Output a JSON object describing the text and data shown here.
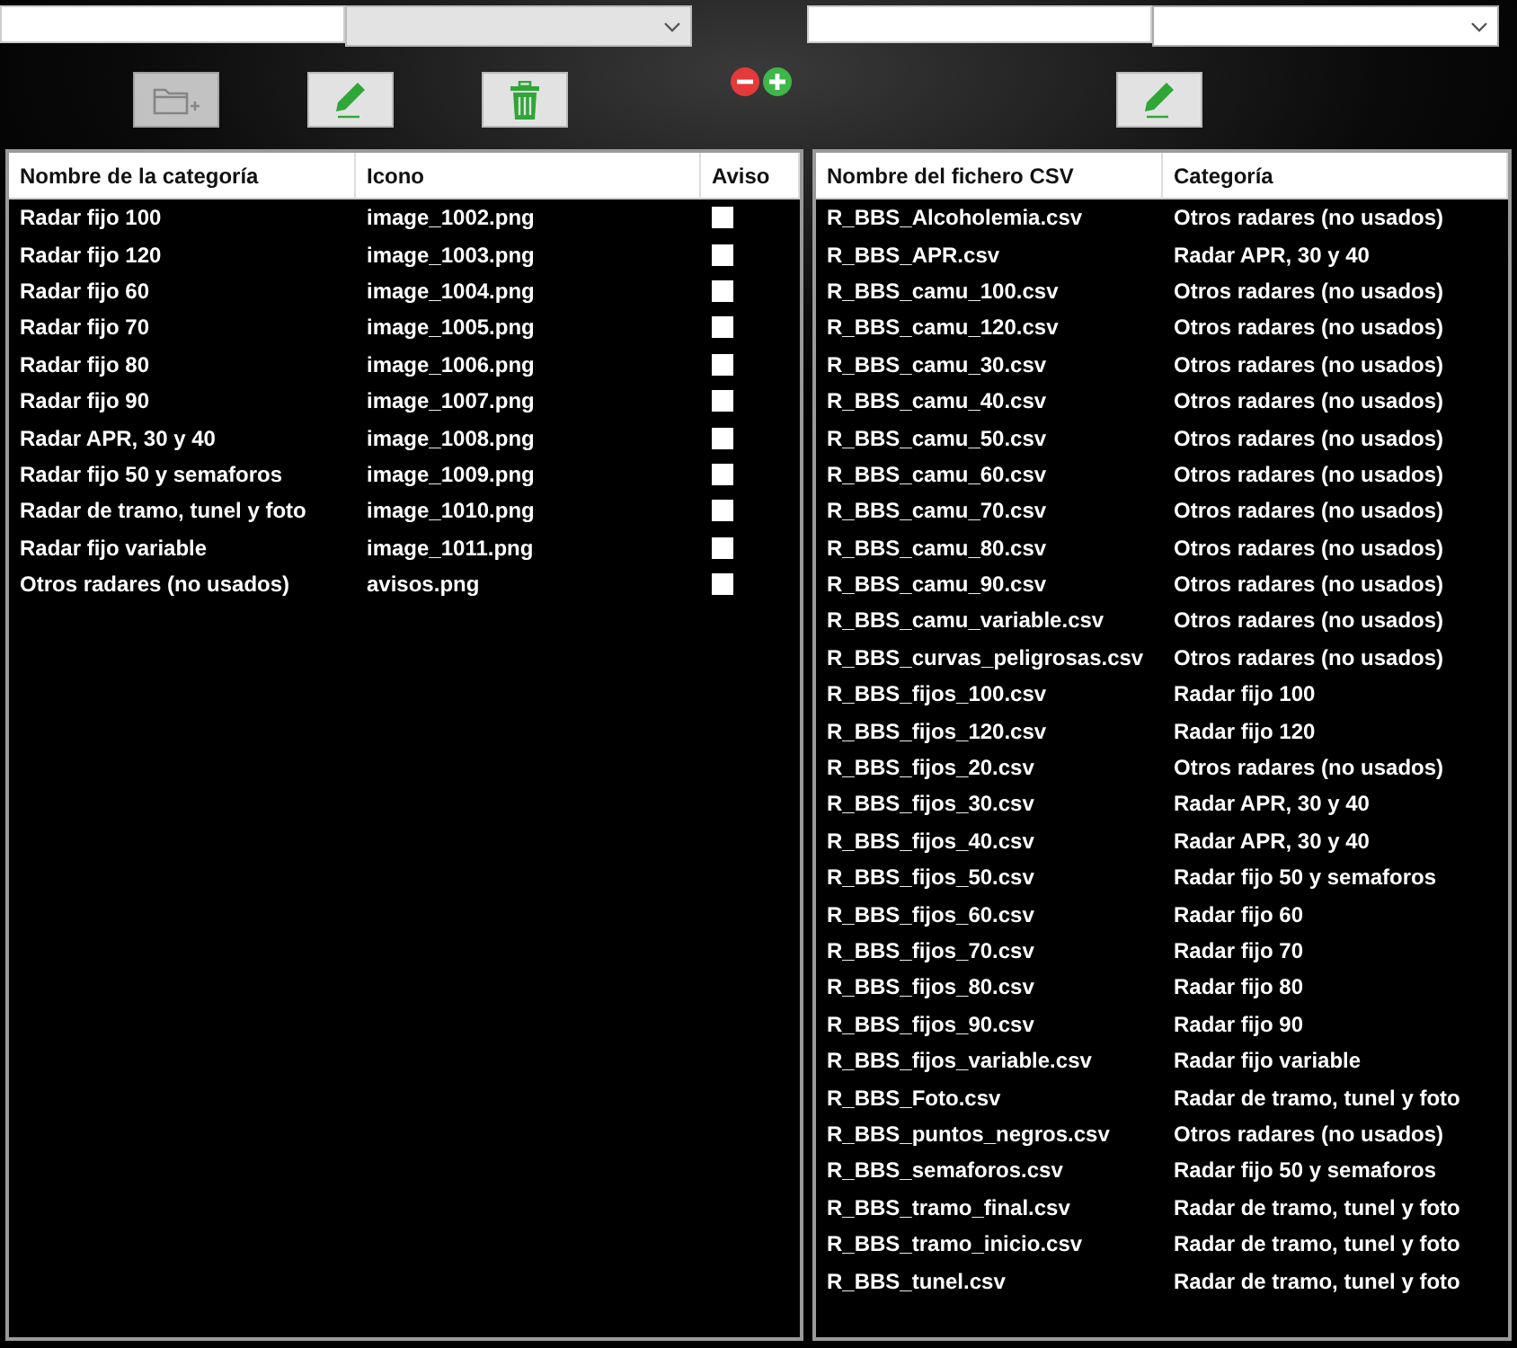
{
  "left_filter": {
    "dropdown": {
      "disabled": true
    }
  },
  "right_filter": {
    "dropdown": {
      "disabled": false
    }
  },
  "toolbar": [
    {
      "kind": "folder-add",
      "disabled": true
    },
    {
      "kind": "edit",
      "disabled": false
    },
    {
      "kind": "delete",
      "disabled": false
    }
  ],
  "zoom_controls": [
    {
      "kind": "minus"
    },
    {
      "kind": "plus"
    }
  ],
  "right_toolbar": [
    {
      "kind": "edit",
      "disabled": false
    }
  ],
  "categories_table": {
    "columns": [
      "Nombre de la categoría",
      "Icono",
      "Aviso"
    ],
    "rows": [
      {
        "name": "Radar fijo 100",
        "icon": "image_1002.png",
        "aviso": false
      },
      {
        "name": "Radar fijo 120",
        "icon": "image_1003.png",
        "aviso": false
      },
      {
        "name": "Radar fijo 60",
        "icon": "image_1004.png",
        "aviso": false
      },
      {
        "name": "Radar fijo 70",
        "icon": "image_1005.png",
        "aviso": false
      },
      {
        "name": "Radar fijo 80",
        "icon": "image_1006.png",
        "aviso": false
      },
      {
        "name": "Radar fijo 90",
        "icon": "image_1007.png",
        "aviso": false
      },
      {
        "name": "Radar APR, 30 y 40",
        "icon": "image_1008.png",
        "aviso": false
      },
      {
        "name": "Radar fijo 50 y semaforos",
        "icon": "image_1009.png",
        "aviso": false
      },
      {
        "name": "Radar de tramo, tunel y foto",
        "icon": "image_1010.png",
        "aviso": false
      },
      {
        "name": "Radar fijo variable",
        "icon": "image_1011.png",
        "aviso": false
      },
      {
        "name": "Otros radares (no usados)",
        "icon": "avisos.png",
        "aviso": false
      }
    ]
  },
  "files_table": {
    "columns": [
      "Nombre del fichero CSV",
      "Categoría"
    ],
    "rows": [
      {
        "file": "R_BBS_Alcoholemia.csv",
        "category": "Otros radares (no usados)"
      },
      {
        "file": "R_BBS_APR.csv",
        "category": "Radar APR, 30 y 40"
      },
      {
        "file": "R_BBS_camu_100.csv",
        "category": "Otros radares (no usados)"
      },
      {
        "file": "R_BBS_camu_120.csv",
        "category": "Otros radares (no usados)"
      },
      {
        "file": "R_BBS_camu_30.csv",
        "category": "Otros radares (no usados)"
      },
      {
        "file": "R_BBS_camu_40.csv",
        "category": "Otros radares (no usados)"
      },
      {
        "file": "R_BBS_camu_50.csv",
        "category": "Otros radares (no usados)"
      },
      {
        "file": "R_BBS_camu_60.csv",
        "category": "Otros radares (no usados)"
      },
      {
        "file": "R_BBS_camu_70.csv",
        "category": "Otros radares (no usados)"
      },
      {
        "file": "R_BBS_camu_80.csv",
        "category": "Otros radares (no usados)"
      },
      {
        "file": "R_BBS_camu_90.csv",
        "category": "Otros radares (no usados)"
      },
      {
        "file": "R_BBS_camu_variable.csv",
        "category": "Otros radares (no usados)"
      },
      {
        "file": "R_BBS_curvas_peligrosas.csv",
        "category": "Otros radares (no usados)"
      },
      {
        "file": "R_BBS_fijos_100.csv",
        "category": "Radar fijo 100"
      },
      {
        "file": "R_BBS_fijos_120.csv",
        "category": "Radar fijo 120"
      },
      {
        "file": "R_BBS_fijos_20.csv",
        "category": "Otros radares (no usados)"
      },
      {
        "file": "R_BBS_fijos_30.csv",
        "category": "Radar APR, 30 y 40"
      },
      {
        "file": "R_BBS_fijos_40.csv",
        "category": "Radar APR, 30 y 40"
      },
      {
        "file": "R_BBS_fijos_50.csv",
        "category": "Radar fijo 50 y semaforos"
      },
      {
        "file": "R_BBS_fijos_60.csv",
        "category": "Radar fijo 60"
      },
      {
        "file": "R_BBS_fijos_70.csv",
        "category": "Radar fijo 70"
      },
      {
        "file": "R_BBS_fijos_80.csv",
        "category": "Radar fijo 80"
      },
      {
        "file": "R_BBS_fijos_90.csv",
        "category": "Radar fijo 90"
      },
      {
        "file": "R_BBS_fijos_variable.csv",
        "category": "Radar fijo variable"
      },
      {
        "file": "R_BBS_Foto.csv",
        "category": "Radar de tramo, tunel y foto"
      },
      {
        "file": "R_BBS_puntos_negros.csv",
        "category": "Otros radares (no usados)"
      },
      {
        "file": "R_BBS_semaforos.csv",
        "category": "Radar fijo 50 y semaforos"
      },
      {
        "file": "R_BBS_tramo_final.csv",
        "category": "Radar de tramo, tunel y foto"
      },
      {
        "file": "R_BBS_tramo_inicio.csv",
        "category": "Radar de tramo, tunel y foto"
      },
      {
        "file": "R_BBS_tunel.csv",
        "category": "Radar de tramo, tunel y foto"
      }
    ]
  }
}
